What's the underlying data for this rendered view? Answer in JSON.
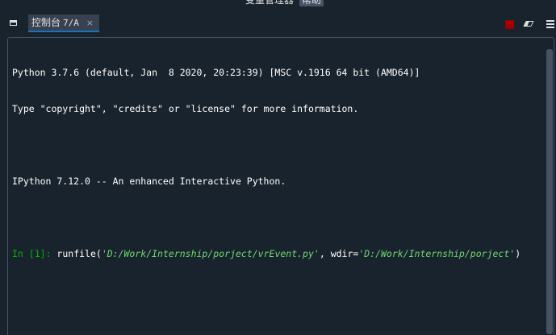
{
  "top_menu": {
    "variable_manager": "变量管理器",
    "help": "帮助"
  },
  "tab": {
    "label": "控制台",
    "suffix": "7/A",
    "close_glyph": "×"
  },
  "icons": {
    "dock": "dock-icon",
    "stop": "stop-icon",
    "clear": "eraser-icon",
    "options": "hamburger-menu-icon"
  },
  "colors": {
    "background": "#19232d",
    "tab_active": "#37414f",
    "tab_underline": "#1a72bb",
    "stop": "#a00000",
    "prompt": "#00b300",
    "string": "#6fd86f"
  },
  "console": {
    "line1": "Python 3.7.6 (default, Jan  8 2020, 20:23:39) [MSC v.1916 64 bit (AMD64)]",
    "line2": "Type \"copyright\", \"credits\" or \"license\" for more information.",
    "line3": "IPython 7.12.0 -- An enhanced Interactive Python.",
    "prompt_open": "In [",
    "prompt_num": "1",
    "prompt_close": "]: ",
    "cmd_func": "runfile(",
    "cmd_arg1": "'D:/Work/Internship/porject/vrEvent.py'",
    "cmd_sep": ", wdir=",
    "cmd_arg2": "'D:/Work/Internship/porject'",
    "cmd_end": ")"
  }
}
